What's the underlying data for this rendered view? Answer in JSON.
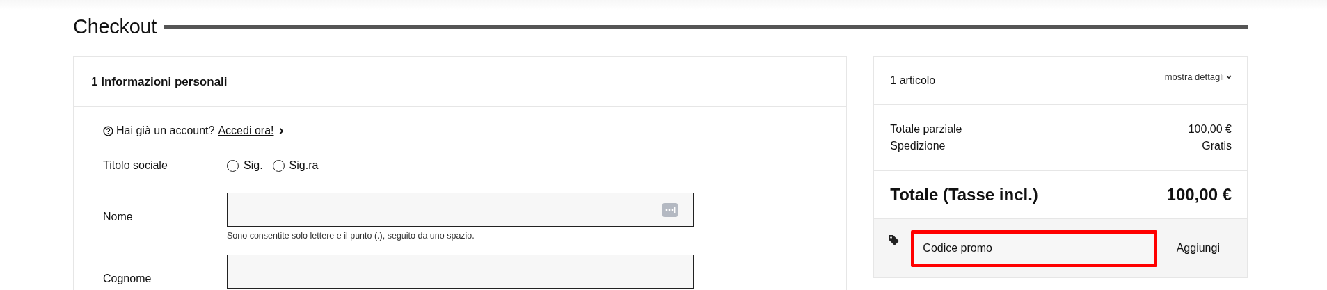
{
  "title": "Checkout",
  "personal": {
    "step": "1 Informazioni personali",
    "account_question": "Hai già un account?",
    "login_link": "Accedi ora!",
    "salutation": {
      "label": "Titolo sociale",
      "options": [
        {
          "label": "Sig.",
          "selected": false
        },
        {
          "label": "Sig.ra",
          "selected": false
        }
      ]
    },
    "fields": [
      {
        "label": "Nome",
        "hint": "Sono consentite solo lettere e il punto (.), seguito da uno spazio.",
        "autofill_icon": true
      },
      {
        "label": "Cognome",
        "autofill_icon": false
      }
    ]
  },
  "summary": {
    "items_count": "1 articolo",
    "details_link": "mostra dettagli",
    "lines": [
      {
        "label": "Totale parziale",
        "value": "100,00 €"
      },
      {
        "label": "Spedizione",
        "value": "Gratis"
      }
    ],
    "total": {
      "label": "Totale (Tasse incl.)",
      "value": "100,00 €"
    },
    "promo": {
      "placeholder": "Codice promo",
      "button": "Aggiungi",
      "highlighted": true
    }
  }
}
